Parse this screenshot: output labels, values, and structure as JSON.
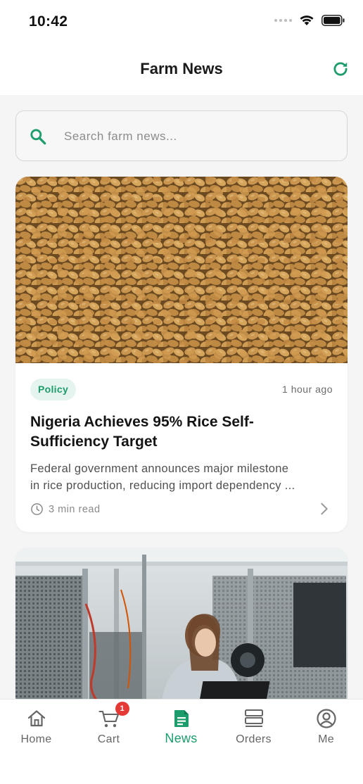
{
  "status_bar": {
    "time": "10:42"
  },
  "header": {
    "title": "Farm News"
  },
  "search": {
    "placeholder": "Search farm news..."
  },
  "articles": [
    {
      "category": "Policy",
      "time_ago": "1 hour ago",
      "title": "Nigeria Achieves 95% Rice Self-Sufficiency Target",
      "title_line1": "Nigeria Achieves 95% Rice Self-",
      "title_line2": "Sufficiency Target",
      "description_line1": "Federal government announces major milestone",
      "description_line2": "in rice production, reducing import dependency ...",
      "read_time": "3 min read",
      "image": "wheat-grains-photo"
    },
    {
      "image": "lab-researcher-photo"
    }
  ],
  "tabs": [
    {
      "label": "Home",
      "icon": "home-icon"
    },
    {
      "label": "Cart",
      "icon": "cart-icon",
      "badge": "1"
    },
    {
      "label": "News",
      "icon": "news-icon",
      "active": true
    },
    {
      "label": "Orders",
      "icon": "orders-icon"
    },
    {
      "label": "Me",
      "icon": "profile-icon"
    }
  ],
  "colors": {
    "accent": "#1d9c6c",
    "badge": "#e53935",
    "badge_bg": "#e5f4ee"
  }
}
